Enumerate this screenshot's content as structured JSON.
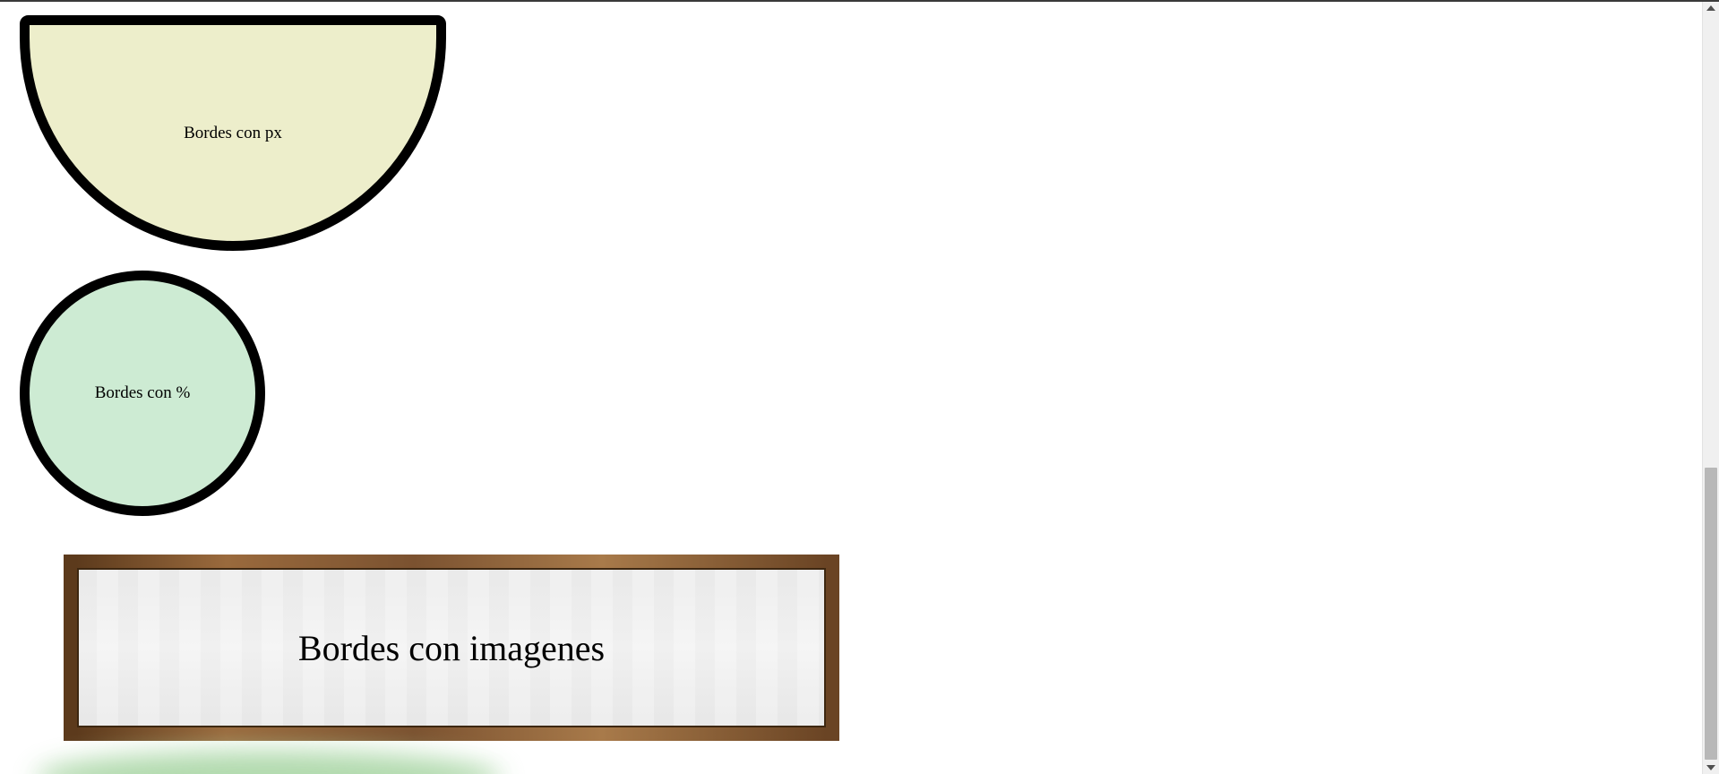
{
  "boxes": {
    "px_label": "Bordes con px",
    "percent_label": "Bordes con %",
    "image_label": "Bordes con imagenes"
  },
  "colors": {
    "px_fill": "#edeecb",
    "percent_fill": "#cdebd3",
    "border": "#000000",
    "frame_wood": "#7d5430",
    "blur_green": "#a9d6a5"
  },
  "icons": {
    "scroll_up": "scroll-up-arrow-icon",
    "scroll_down": "scroll-down-arrow-icon"
  }
}
